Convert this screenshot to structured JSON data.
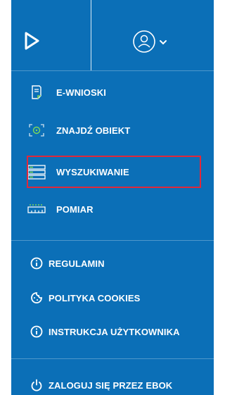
{
  "colors": {
    "panel": "#0b6fb7",
    "highlight_border": "#e0283a",
    "text": "#ffffff"
  },
  "header": {
    "logo_icon": "play-triangle-icon",
    "user_icon": "user-circle-icon",
    "dropdown_icon": "chevron-down-icon"
  },
  "menu": [
    {
      "label": "E-WNIOSKI",
      "icon": "document-icon"
    },
    {
      "label": "ZNAJDŹ OBIEKT",
      "icon": "locate-target-icon"
    },
    {
      "label": "WYSZUKIWANIE",
      "icon": "list-search-icon",
      "highlighted": true
    },
    {
      "label": "POMIAR",
      "icon": "ruler-measure-icon"
    }
  ],
  "links": [
    {
      "label": "REGULAMIN",
      "icon": "info-icon"
    },
    {
      "label": "POLITYKA COOKIES",
      "icon": "cookie-icon"
    },
    {
      "label": "INSTRUKCJA UŻYTKOWNIKA",
      "icon": "info-icon"
    }
  ],
  "footer": {
    "label": "ZALOGUJ SIĘ PRZEZ EBOK",
    "icon": "power-icon"
  }
}
